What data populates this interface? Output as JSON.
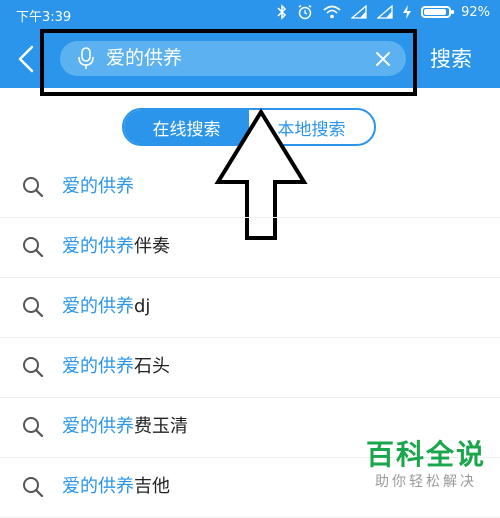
{
  "status_bar": {
    "time": "下午3:39",
    "battery_percent": "92%",
    "battery_level": 0.92
  },
  "search": {
    "query": "爱的供养",
    "button_label": "搜索"
  },
  "tabs": [
    {
      "label": "在线搜索",
      "active": true
    },
    {
      "label": "本地搜索",
      "active": false
    }
  ],
  "suggestions": [
    {
      "highlight": "爱的供养",
      "rest": ""
    },
    {
      "highlight": "爱的供养",
      "rest": "伴奏"
    },
    {
      "highlight": "爱的供养",
      "rest": "dj"
    },
    {
      "highlight": "爱的供养",
      "rest": "石头"
    },
    {
      "highlight": "爱的供养",
      "rest": "费玉清"
    },
    {
      "highlight": "爱的供养",
      "rest": "吉他"
    }
  ],
  "watermark": {
    "title": "百科全说",
    "subtitle": "助你轻松解决"
  },
  "colors": {
    "accent": "#2a95ea",
    "search_field": "#5cb1f1",
    "watermark_green": "#1aa64a"
  },
  "icons": [
    "back-icon",
    "bluetooth-icon",
    "alarm-icon",
    "wifi-icon",
    "signal-icon",
    "charging-icon",
    "battery-icon",
    "mic-icon",
    "clear-icon",
    "search-icon"
  ]
}
